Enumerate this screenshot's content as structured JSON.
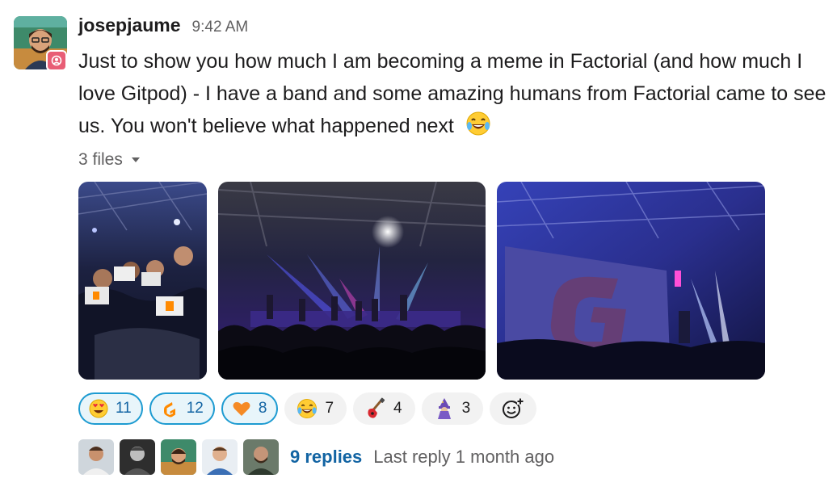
{
  "message": {
    "username": "josepjaume",
    "time": "9:42 AM",
    "text": "Just to show you how much I am becoming a meme in Factorial (and how much I love Gitpod) - I have a band and some amazing humans from Factorial came to see us. You won't believe what happened next",
    "text_emoji": "joy-emoji"
  },
  "files": {
    "label": "3 files",
    "items": [
      {
        "icon": "crowd-photo"
      },
      {
        "icon": "concert-stage-photo"
      },
      {
        "icon": "gitpod-sign-photo"
      }
    ]
  },
  "reactions": [
    {
      "emoji": "heart-eyes-emoji",
      "count": "11",
      "active": true
    },
    {
      "emoji": "gitpod-emoji",
      "count": "12",
      "active": true
    },
    {
      "emoji": "orange-heart-emoji",
      "count": "8",
      "active": true
    },
    {
      "emoji": "joy-emoji",
      "count": "7",
      "active": false
    },
    {
      "emoji": "guitar-emoji",
      "count": "4",
      "active": false
    },
    {
      "emoji": "wizard-emoji",
      "count": "3",
      "active": false
    }
  ],
  "thread": {
    "replies": "9 replies",
    "last_reply": "Last reply 1 month ago"
  },
  "colors": {
    "link": "#1264a3",
    "active_reaction_border": "#1d9bd1",
    "active_reaction_bg": "#e8f5fa",
    "gitpod_orange": "#ff8a00"
  }
}
